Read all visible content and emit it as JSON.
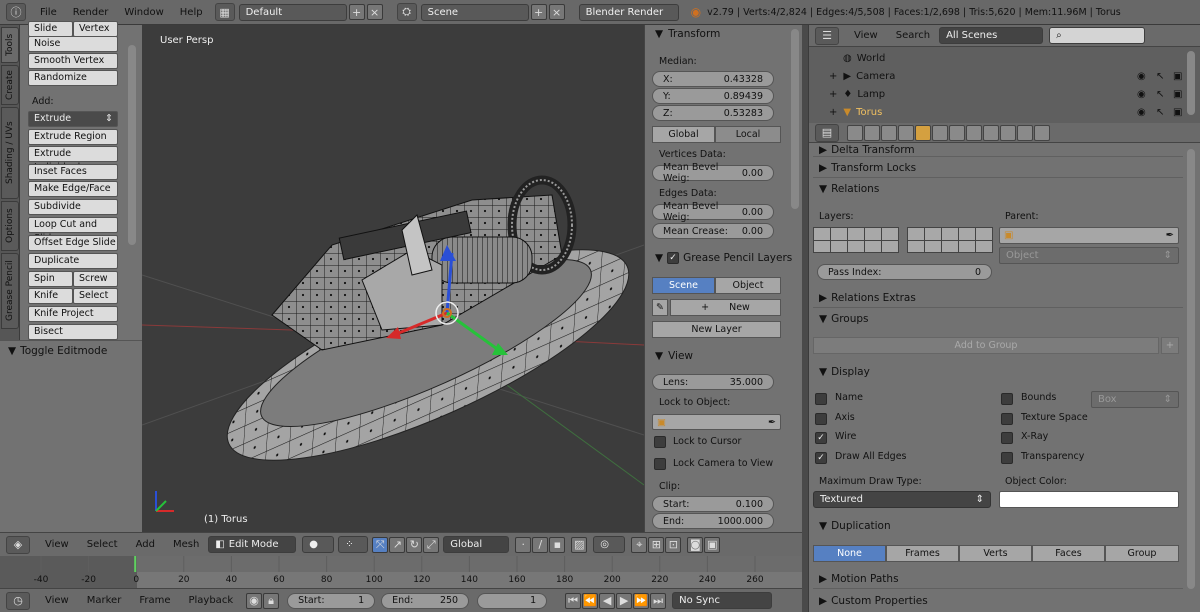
{
  "topbar": {
    "menus": [
      "File",
      "Render",
      "Window",
      "Help"
    ],
    "layout": "Default",
    "scene": "Scene",
    "engine": "Blender Render",
    "stats": "v2.79 | Verts:4/2,824 | Edges:4/5,508 | Faces:1/2,698 | Tris:5,620 | Mem:11.96M | Torus"
  },
  "tabs": [
    "Tools",
    "Create",
    "Shading / UVs",
    "Options",
    "Grease Pencil"
  ],
  "tools": {
    "top_buttons": [
      [
        "Slide Ed",
        "Vertex"
      ]
    ],
    "buttons1": [
      "Noise",
      "Smooth Vertex",
      "Randomize"
    ],
    "add_label": "Add:",
    "extrude": "Extrude",
    "buttons2": [
      "Extrude Region",
      "Extrude Individual",
      "Inset Faces",
      "Make Edge/Face",
      "Subdivide",
      "Loop Cut and Slide",
      "Offset Edge Slide",
      "Duplicate"
    ],
    "pairs": [
      [
        "Spin",
        "Screw"
      ],
      [
        "Knife",
        "Select"
      ]
    ],
    "buttons3": [
      "Knife Project",
      "Bisect"
    ],
    "toggle": "Toggle Editmode"
  },
  "viewport": {
    "label": "User Persp",
    "object": "(1) Torus"
  },
  "npanel": {
    "transform": "Transform",
    "median": "Median:",
    "x_label": "X:",
    "x": "0.43328",
    "y_label": "Y:",
    "y": "0.89439",
    "z_label": "Z:",
    "z": "0.53283",
    "global": "Global",
    "local": "Local",
    "vertices_data": "Vertices Data:",
    "mean_bevel_v": "Mean Bevel Weig:",
    "mean_bevel_v_val": "0.00",
    "edges_data": "Edges Data:",
    "mean_bevel_e": "Mean Bevel Weig:",
    "mean_bevel_e_val": "0.00",
    "mean_crease": "Mean Crease:",
    "mean_crease_val": "0.00",
    "gp_layers": "Grease Pencil Layers",
    "scene": "Scene",
    "object": "Object",
    "new": "New",
    "new_layer": "New Layer",
    "view": "View",
    "lens_label": "Lens:",
    "lens": "35.000",
    "lock_to_object": "Lock to Object:",
    "lock_to_cursor": "Lock to Cursor",
    "lock_camera": "Lock Camera to View",
    "clip": "Clip:",
    "start_label": "Start:",
    "start": "0.100",
    "end_label": "End:",
    "end": "1000.000"
  },
  "outliner": {
    "view": "View",
    "search": "Search",
    "filter": "All Scenes",
    "items": [
      "World",
      "Camera",
      "Lamp",
      "Torus"
    ]
  },
  "props": {
    "delta": "Delta Transform",
    "transform_locks": "Transform Locks",
    "relations": "Relations",
    "layers": "Layers:",
    "parent": "Parent:",
    "object_placeholder": "Object",
    "pass_index_label": "Pass Index:",
    "pass_index": "0",
    "relations_extras": "Relations Extras",
    "groups": "Groups",
    "add_to_group": "Add to Group",
    "display": "Display",
    "left_checks": [
      {
        "label": "Name",
        "on": false
      },
      {
        "label": "Axis",
        "on": false
      },
      {
        "label": "Wire",
        "on": true
      },
      {
        "label": "Draw All Edges",
        "on": true
      }
    ],
    "right_checks": [
      {
        "label": "Bounds",
        "on": false
      },
      {
        "label": "Texture Space",
        "on": false
      },
      {
        "label": "X-Ray",
        "on": false
      },
      {
        "label": "Transparency",
        "on": false
      }
    ],
    "box": "Box",
    "max_draw_type": "Maximum Draw Type:",
    "textured": "Textured",
    "object_color": "Object Color:",
    "duplication": "Duplication",
    "dup_options": [
      "None",
      "Frames",
      "Verts",
      "Faces",
      "Group"
    ],
    "motion_paths": "Motion Paths",
    "custom_properties": "Custom Properties"
  },
  "v3dheader": {
    "menus": [
      "View",
      "Select",
      "Add",
      "Mesh"
    ],
    "mode": "Edit Mode",
    "orientation": "Global"
  },
  "timeline": {
    "ticks": [
      "-40",
      "-20",
      "0",
      "20",
      "40",
      "60",
      "80",
      "100",
      "120",
      "140",
      "160",
      "180",
      "200",
      "220",
      "240",
      "260"
    ],
    "current_frame_value": 0
  },
  "tlheader": {
    "menus": [
      "View",
      "Marker",
      "Frame",
      "Playback"
    ],
    "start_label": "Start:",
    "start": "1",
    "end_label": "End:",
    "end": "250",
    "current": "1",
    "sync": "No Sync"
  }
}
